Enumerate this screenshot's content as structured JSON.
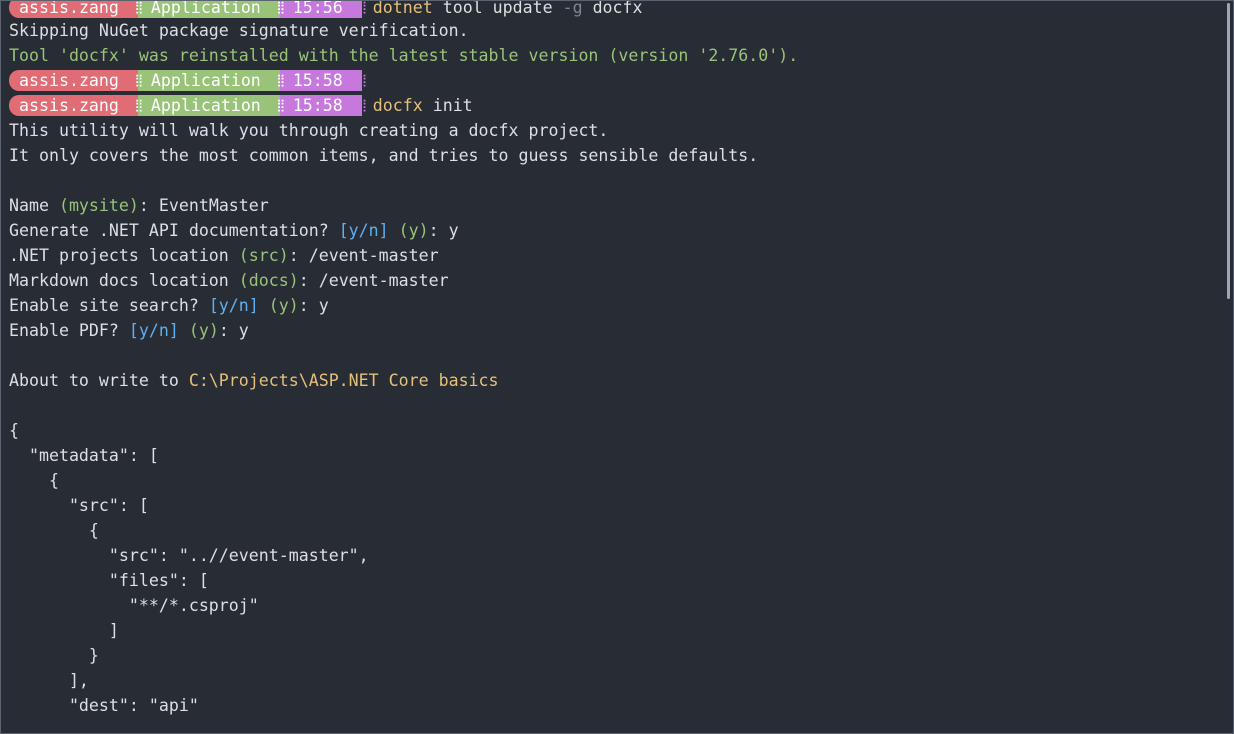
{
  "prompt": {
    "user": "assis.zang",
    "dir": "Application",
    "separator_icon": "powerline-separator-icon"
  },
  "lines": {
    "p1_time": "15:56",
    "p1_cmd": "dotnet",
    "p1_args1": " tool update ",
    "p1_flag": "-g",
    "p1_args2": " docfx",
    "skip": "Skipping NuGet package signature verification.",
    "reinstalled": "Tool 'docfx' was reinstalled with the latest stable version (version '2.76.0').",
    "p2_time": "15:58",
    "p3_time": "15:58",
    "p3_cmd": "docfx",
    "p3_args": " init",
    "util1": "This utility will walk you through creating a docfx project.",
    "util2": "It only covers the most common items, and tries to guess sensible defaults.",
    "name_label": "Name ",
    "name_default": "(mysite)",
    "name_value": ": EventMaster",
    "gen_label": "Generate .NET API documentation? ",
    "gen_opts": "[y/n]",
    "gen_default": " (y)",
    "gen_value": ": y",
    "proj_label": ".NET projects location ",
    "proj_default": "(src)",
    "proj_value": ": /event-master",
    "md_label": "Markdown docs location ",
    "md_default": "(docs)",
    "md_value": ": /event-master",
    "search_label": "Enable site search? ",
    "search_opts": "[y/n]",
    "search_default": " (y)",
    "search_value": ": y",
    "pdf_label": "Enable PDF? ",
    "pdf_opts": "[y/n]",
    "pdf_default": " (y)",
    "pdf_value": ": y",
    "write_label": "About to write to ",
    "write_path": "C:\\Projects\\ASP.NET Core basics",
    "j1": "{",
    "j2": "  \"metadata\": [",
    "j3": "    {",
    "j4": "      \"src\": [",
    "j5": "        {",
    "j6": "          \"src\": \"..//event-master\",",
    "j7": "          \"files\": [",
    "j8": "            \"**/*.csproj\"",
    "j9": "          ]",
    "j10": "        }",
    "j11": "      ],",
    "j12": "      \"dest\": \"api\""
  },
  "colors": {
    "background": "#282c34",
    "user_segment": "#e06c75",
    "dir_segment": "#98c379",
    "time_segment": "#c678dd",
    "command": "#e5c07b",
    "default_hint": "#98c379",
    "options_hint": "#61afef"
  }
}
